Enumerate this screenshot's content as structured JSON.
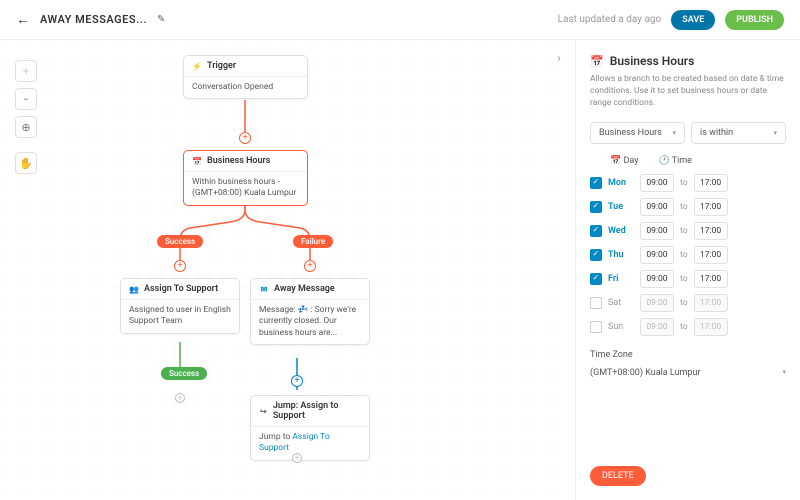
{
  "header": {
    "title": "AWAY MESSAGES...",
    "updated": "Last updated a day ago",
    "save": "SAVE",
    "publish": "PUBLISH"
  },
  "nodes": {
    "trigger": {
      "title": "Trigger",
      "body": "Conversation Opened"
    },
    "bh": {
      "title": "Business Hours",
      "body": "Within business hours - (GMT+08:00) Kuala Lumpur"
    },
    "assign": {
      "title": "Assign To Support",
      "body": "Assigned to user in English Support Team"
    },
    "away": {
      "title": "Away Message",
      "body": "Message: 💤 : Sorry we're currently closed. Our business hours are..."
    },
    "jump": {
      "title": "Jump: Assign to Support",
      "body_pre": "Jump to ",
      "body_link": "Assign To Support"
    }
  },
  "pills": {
    "success": "Success",
    "failure": "Failure"
  },
  "panel": {
    "title": "Business Hours",
    "desc": "Allows a branch to be created based on date & time conditions. Use it to set business hours or date range conditions.",
    "sel1": "Business Hours",
    "sel2": "is within",
    "day_lbl": "Day",
    "time_lbl": "Time",
    "days": [
      {
        "d": "Mon",
        "on": true,
        "f": "09:00",
        "t": "17:00"
      },
      {
        "d": "Tue",
        "on": true,
        "f": "09:00",
        "t": "17:00"
      },
      {
        "d": "Wed",
        "on": true,
        "f": "09:00",
        "t": "17:00"
      },
      {
        "d": "Thu",
        "on": true,
        "f": "09:00",
        "t": "17:00"
      },
      {
        "d": "Fri",
        "on": true,
        "f": "09:00",
        "t": "17:00"
      },
      {
        "d": "Sat",
        "on": false,
        "f": "09:00",
        "t": "17:00"
      },
      {
        "d": "Sun",
        "on": false,
        "f": "09:00",
        "t": "17:00"
      }
    ],
    "to": "to",
    "tz_lbl": "Time Zone",
    "tz": "(GMT+08:00) Kuala Lumpur",
    "delete": "DELETE"
  }
}
